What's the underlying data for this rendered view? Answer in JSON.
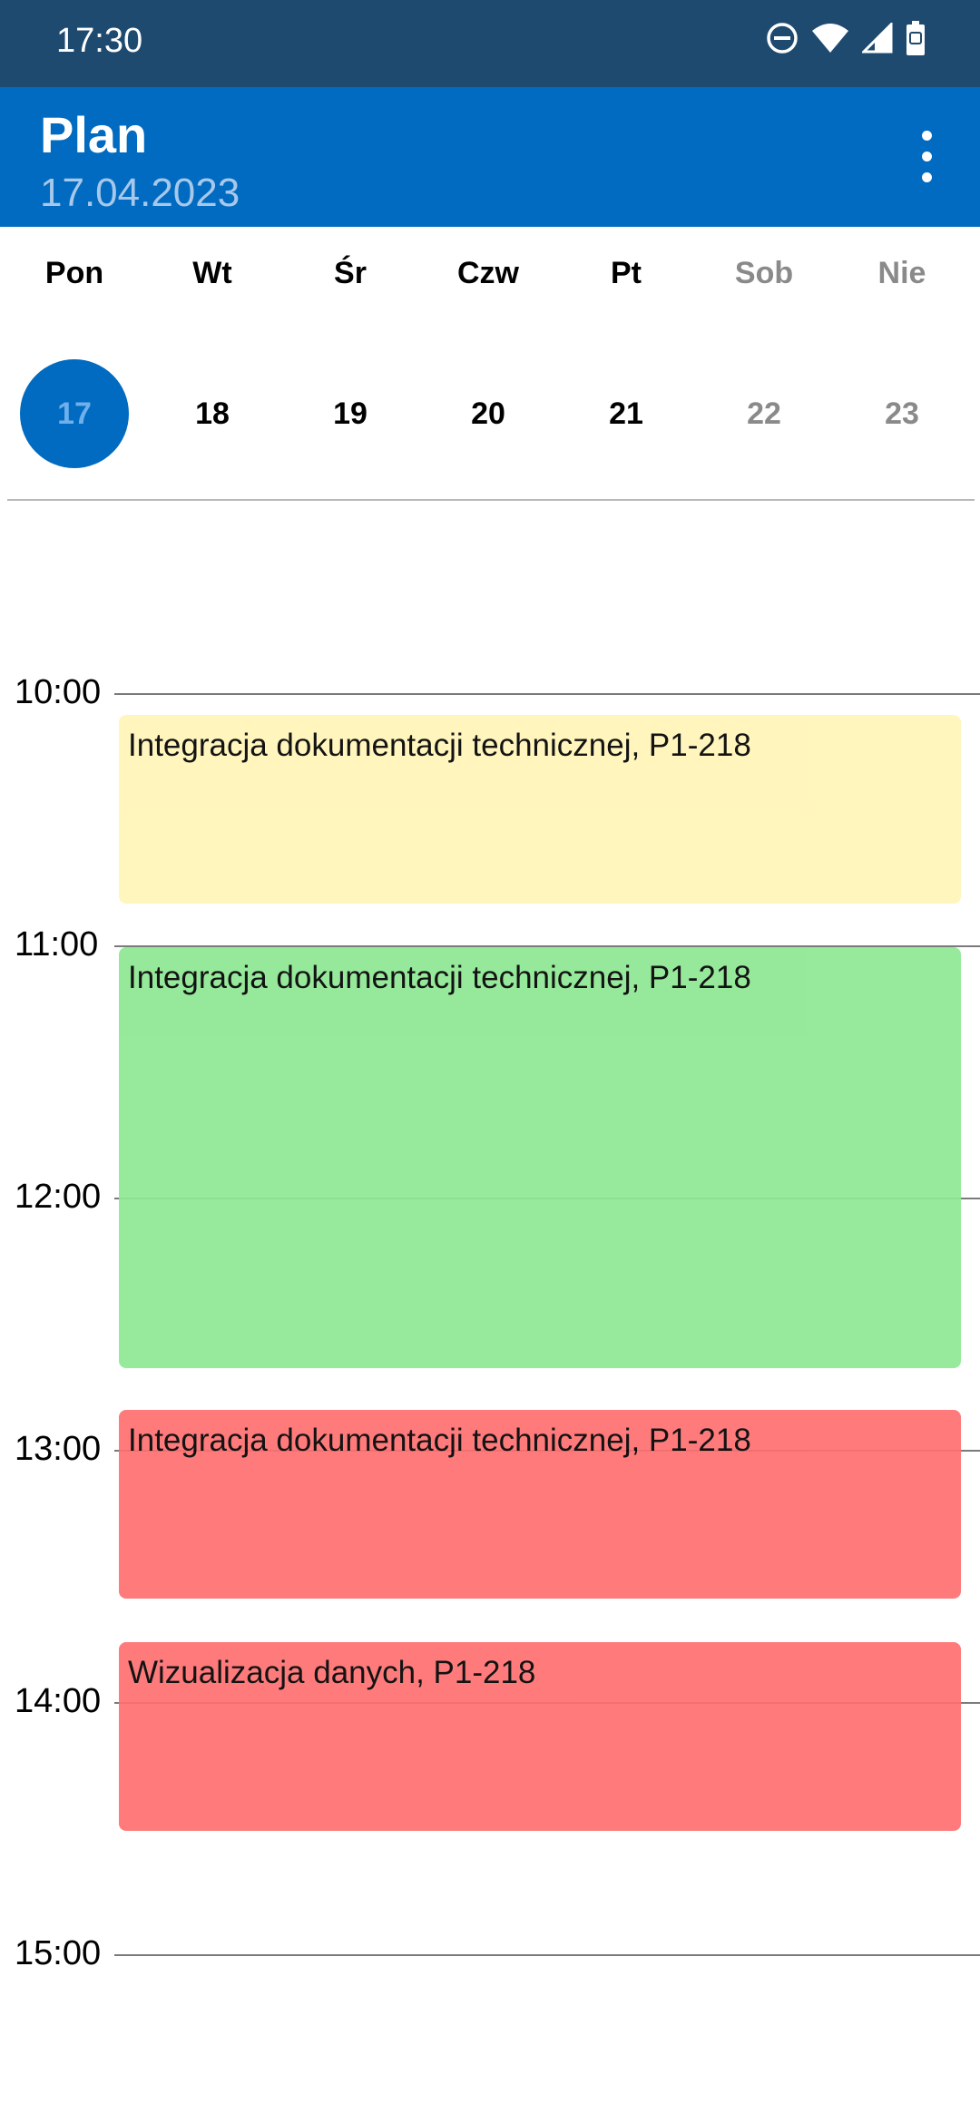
{
  "status_bar": {
    "time": "17:30",
    "icons": [
      "do-not-disturb-icon",
      "wifi-icon",
      "signal-icon",
      "battery-icon"
    ]
  },
  "app_bar": {
    "title": "Plan",
    "subtitle": "17.04.2023",
    "menu_icon": "more-vert-icon",
    "colors": {
      "bar": "#006bc0",
      "status_bar": "#1f4a70",
      "subtitle": "#a7c8ea"
    }
  },
  "week": {
    "days": [
      {
        "name": "Pon",
        "date": "17",
        "selected": true,
        "weekend": false
      },
      {
        "name": "Wt",
        "date": "18",
        "selected": false,
        "weekend": false
      },
      {
        "name": "Śr",
        "date": "19",
        "selected": false,
        "weekend": false
      },
      {
        "name": "Czw",
        "date": "20",
        "selected": false,
        "weekend": false
      },
      {
        "name": "Pt",
        "date": "21",
        "selected": false,
        "weekend": false
      },
      {
        "name": "Sob",
        "date": "22",
        "selected": false,
        "weekend": true
      },
      {
        "name": "Nie",
        "date": "23",
        "selected": false,
        "weekend": true
      }
    ]
  },
  "timeline": {
    "hours": [
      "10:00",
      "11:00",
      "12:00",
      "13:00",
      "14:00",
      "15:00"
    ],
    "events": [
      {
        "title": "Integracja dokumentacji technicznej, P1-218",
        "start": "10:05",
        "end": "10:50",
        "color": "#fff5b8"
      },
      {
        "title": "Integracja dokumentacji technicznej, P1-218",
        "start": "11:00",
        "end": "12:40",
        "color": "#8ee893"
      },
      {
        "title": "Integracja dokumentacji technicznej, P1-218",
        "start": "12:50",
        "end": "13:35",
        "color": "#ff7070"
      },
      {
        "title": "Wizualizacja danych, P1-218",
        "start": "13:45",
        "end": "14:30",
        "color": "#ff7070"
      }
    ]
  }
}
